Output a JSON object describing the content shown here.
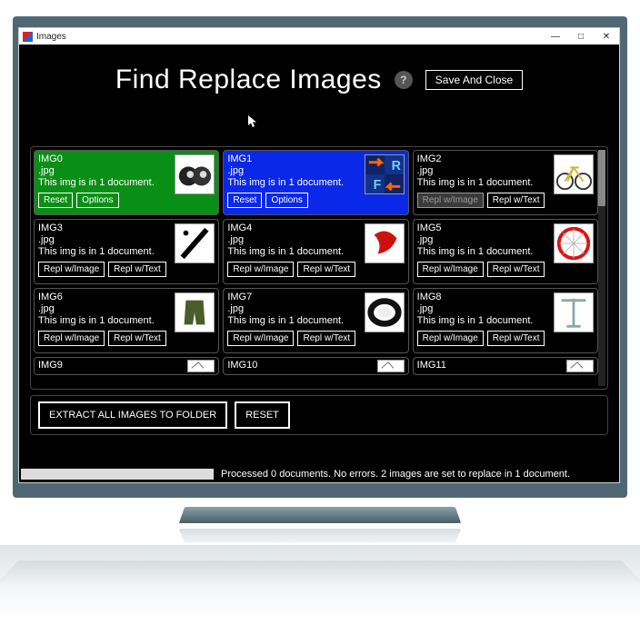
{
  "window": {
    "title": "Images",
    "minimize": "—",
    "maximize": "□",
    "close": "✕"
  },
  "header": {
    "title": "Find Replace Images",
    "help": "?",
    "save": "Save And Close"
  },
  "cell_buttons": {
    "reset": "Reset",
    "options": "Options",
    "repl_image": "Repl w/Image",
    "repl_text": "Repl w/Text"
  },
  "cells": [
    {
      "name": "IMG0",
      "ext": ".jpg",
      "note": "This img is in 1 document.",
      "mode": "reset",
      "sel": "green",
      "icon": "binocular"
    },
    {
      "name": "IMG1",
      "ext": ".jpg",
      "note": "This img is in 1 document.",
      "mode": "reset",
      "sel": "blue",
      "icon": "fr"
    },
    {
      "name": "IMG2",
      "ext": ".jpg",
      "note": "This img is in 1 document.",
      "mode": "repl",
      "sel": "",
      "icon": "bike",
      "dark_first": true
    },
    {
      "name": "IMG3",
      "ext": ".jpg",
      "note": "This img is in 1 document.",
      "mode": "repl",
      "sel": "",
      "icon": "slash"
    },
    {
      "name": "IMG4",
      "ext": ".jpg",
      "note": "This img is in 1 document.",
      "mode": "repl",
      "sel": "",
      "icon": "red-swirl"
    },
    {
      "name": "IMG5",
      "ext": ".jpg",
      "note": "This img is in 1 document.",
      "mode": "repl",
      "sel": "",
      "icon": "red-wheel"
    },
    {
      "name": "IMG6",
      "ext": ".jpg",
      "note": "This img is in 1 document.",
      "mode": "repl",
      "sel": "",
      "icon": "shorts"
    },
    {
      "name": "IMG7",
      "ext": ".jpg",
      "note": "This img is in 1 document.",
      "mode": "repl",
      "sel": "",
      "icon": "tire"
    },
    {
      "name": "IMG8",
      "ext": ".jpg",
      "note": "This img is in 1 document.",
      "mode": "repl",
      "sel": "",
      "icon": "stand"
    },
    {
      "name": "IMG9",
      "short": true,
      "icon": "tiny"
    },
    {
      "name": "IMG10",
      "short": true,
      "icon": "tiny"
    },
    {
      "name": "IMG11",
      "short": true,
      "icon": "tiny"
    }
  ],
  "footer": {
    "extract": "EXTRACT ALL IMAGES TO FOLDER",
    "reset": "RESET"
  },
  "status": "Processed 0 documents. No errors. 2 images are set to replace in 1 document."
}
